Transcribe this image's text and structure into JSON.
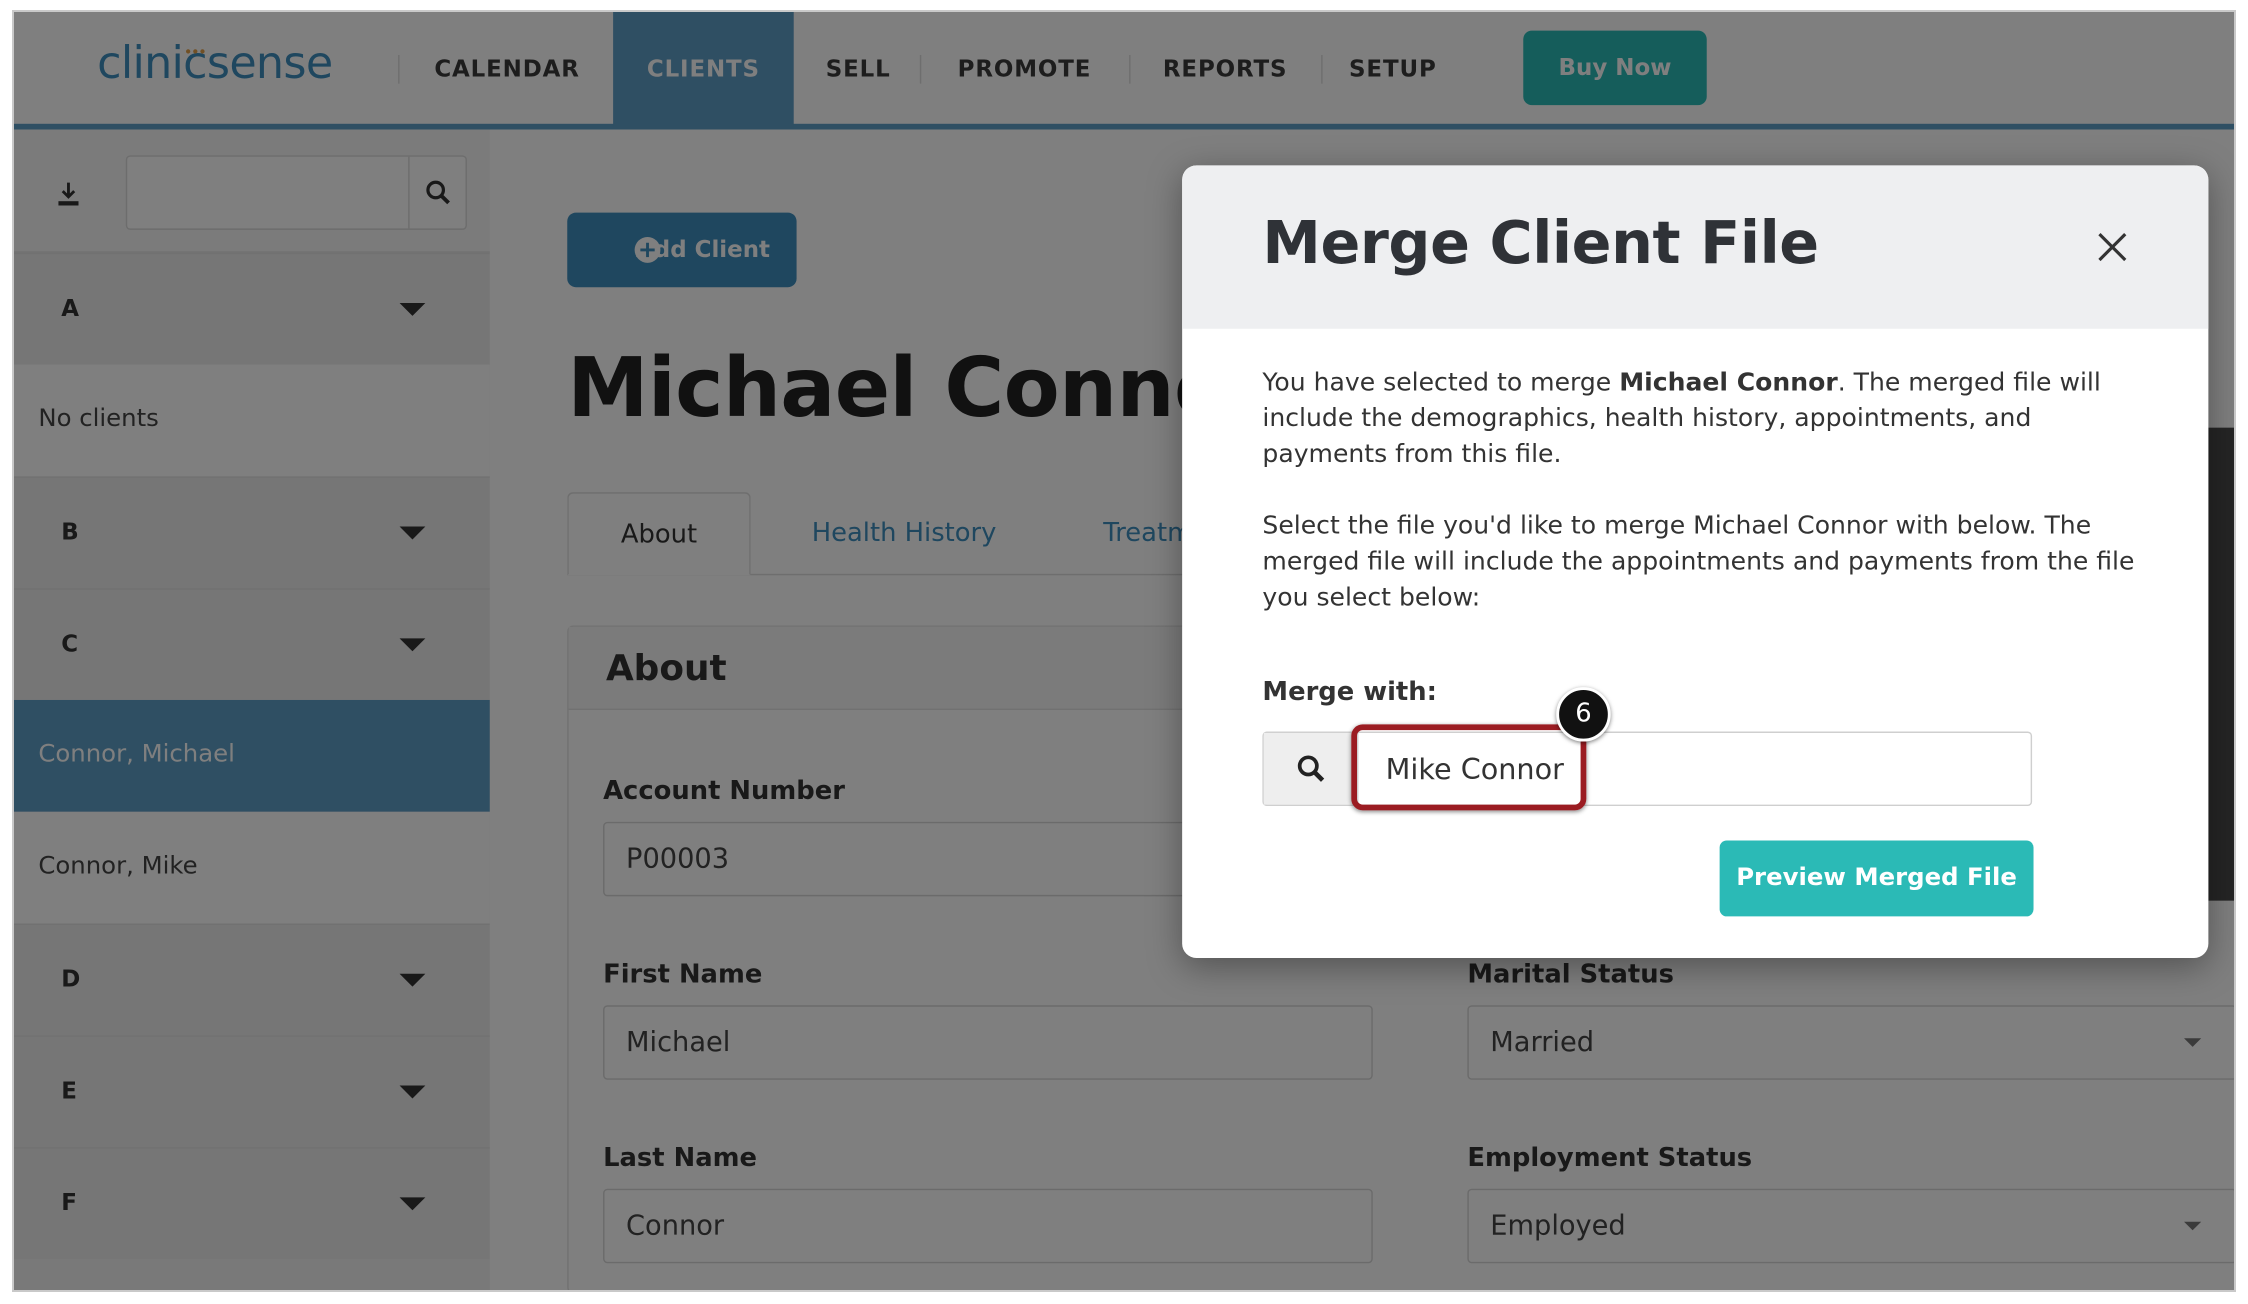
{
  "app": {
    "logo_text": "clinicsense",
    "nav": [
      "CALENDAR",
      "CLIENTS",
      "SELL",
      "PROMOTE",
      "REPORTS",
      "SETUP"
    ],
    "active_nav": "CLIENTS",
    "buy_label": "Buy Now"
  },
  "sidebar": {
    "search_value": "",
    "groups": [
      {
        "letter": "A",
        "clients": [],
        "empty_text": "No clients"
      },
      {
        "letter": "B",
        "clients": []
      },
      {
        "letter": "C",
        "clients": [
          "Connor, Michael",
          "Connor, Mike"
        ],
        "selected": "Connor, Michael"
      },
      {
        "letter": "D",
        "clients": []
      },
      {
        "letter": "E",
        "clients": []
      },
      {
        "letter": "F",
        "clients": []
      }
    ]
  },
  "main": {
    "add_client_label": "Add Client",
    "client_name": "Michael Connor",
    "tabs": [
      "About",
      "Health History",
      "Treatm"
    ],
    "active_tab": "About",
    "section_title": "About",
    "fields": {
      "account_number": {
        "label": "Account Number",
        "value": "P00003"
      },
      "first_name": {
        "label": "First Name",
        "value": "Michael"
      },
      "last_name": {
        "label": "Last Name",
        "value": "Connor"
      },
      "marital_status": {
        "label": "Marital Status",
        "value": "Married"
      },
      "employment_status": {
        "label": "Employment Status",
        "value": "Employed"
      }
    }
  },
  "modal": {
    "title": "Merge Client File",
    "para1_prefix": "You have selected to merge ",
    "para1_name": "Michael Connor",
    "para1_suffix": ". The merged file will include the demographics, health history, appointments, and payments from this file.",
    "para2": "Select the file you'd like to merge Michael Connor with below. The merged file will include the appointments and payments from the file you select below:",
    "merge_label": "Merge with:",
    "merge_value": "Mike Connor",
    "preview_label": "Preview Merged File"
  },
  "annotation": {
    "step_number": "6",
    "highlight_color": "#9b1c22"
  },
  "colors": {
    "accent_blue": "#5e9ec6",
    "teal": "#2bbab6",
    "link_blue": "#3e8fbf"
  }
}
